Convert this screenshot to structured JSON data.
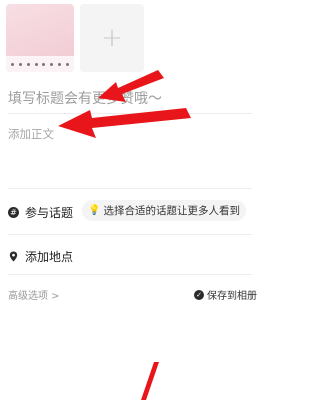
{
  "media": {
    "add_symbol": "+"
  },
  "note": {
    "title_placeholder": "填写标题会有更多赞哦～",
    "body_placeholder": "添加正文"
  },
  "topic": {
    "icon_glyph": "#",
    "label": "参与话题",
    "suggestion_icon": "💡",
    "suggestion_text": "选择合适的话题让更多人看到"
  },
  "location": {
    "label": "添加地点"
  },
  "footer": {
    "advanced_label": "高级选项 >",
    "save_label": "保存到相册",
    "save_icon": "✓"
  },
  "annotations": {
    "arrow_color": "#e8161a"
  }
}
